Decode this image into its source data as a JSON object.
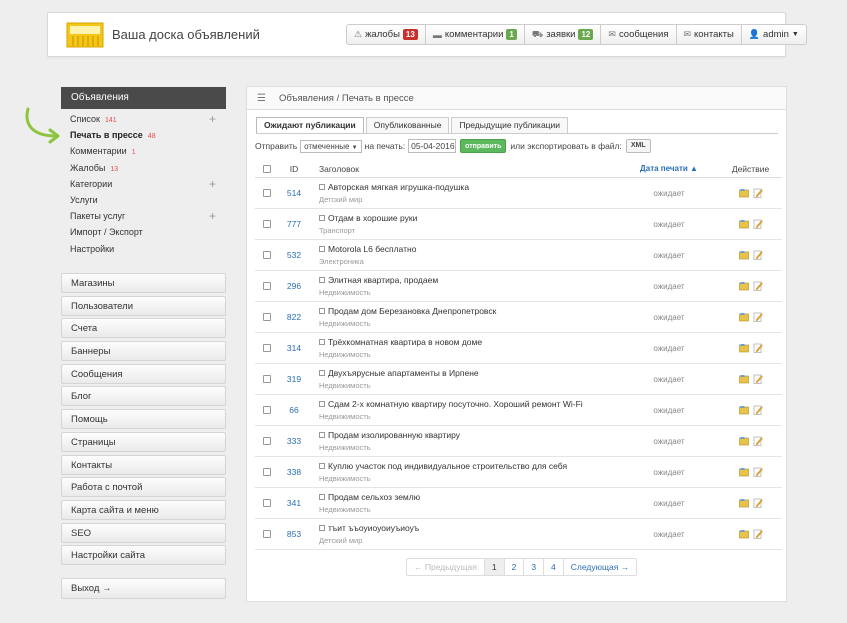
{
  "header": {
    "site_title": "Ваша доска объявлений",
    "nav": [
      {
        "icon": "warning-icon",
        "label": "жалобы",
        "badge": "13",
        "badge_color": "#c9302c"
      },
      {
        "icon": "comment-icon",
        "label": "комментарии",
        "badge": "1",
        "badge_color": "#6aa84f"
      },
      {
        "icon": "cart-icon",
        "label": "заявки",
        "badge": "12",
        "badge_color": "#6aa84f"
      },
      {
        "icon": "envelope-icon",
        "label": "сообщения",
        "badge": null
      },
      {
        "icon": "envelope-icon",
        "label": "контакты",
        "badge": null
      },
      {
        "icon": "user-icon",
        "label": "admin",
        "badge": null
      }
    ]
  },
  "sidebar": {
    "section_title": "Объявления",
    "items": [
      {
        "label": "Список",
        "count": "141",
        "plus": true,
        "active": false
      },
      {
        "label": "Печать в прессе",
        "count": "48",
        "plus": false,
        "active": true
      },
      {
        "label": "Комментарии",
        "count": "1",
        "plus": false,
        "active": false
      },
      {
        "label": "Жалобы",
        "count": "13",
        "plus": false,
        "active": false
      },
      {
        "label": "Категории",
        "count": "",
        "plus": true,
        "active": false
      },
      {
        "label": "Услуги",
        "count": "",
        "plus": false,
        "active": false
      },
      {
        "label": "Пакеты услуг",
        "count": "",
        "plus": true,
        "active": false
      },
      {
        "label": "Импорт / Экспорт",
        "count": "",
        "plus": false,
        "active": false
      },
      {
        "label": "Настройки",
        "count": "",
        "plus": false,
        "active": false
      }
    ],
    "menu": [
      "Магазины",
      "Пользователи",
      "Счета",
      "Баннеры",
      "Сообщения",
      "Блог",
      "Помощь",
      "Страницы",
      "Контакты",
      "Работа с почтой",
      "Карта сайта и меню",
      "SEO",
      "Настройки сайта"
    ],
    "exit_label": "Выход →"
  },
  "main": {
    "breadcrumb": "Объявления / Печать в прессе",
    "tabs": [
      "Ожидают публикации",
      "Опубликованные",
      "Предыдущие публикации"
    ],
    "filter": {
      "send_label": "Отправить",
      "select_value": "отмеченные",
      "to_print_label": "на печать:",
      "date_value": "05-04-2016",
      "send_button": "отправить",
      "export_label": "или экспортировать в файл:",
      "xml_button": "XML"
    },
    "columns": {
      "id": "ID",
      "title": "Заголовок",
      "date": "Дата печати ▲",
      "action": "Действие"
    },
    "rows": [
      {
        "id": "514",
        "title": "Авторская мягкая игрушка-подушка",
        "category": "Детский мир",
        "status": "ожидает"
      },
      {
        "id": "777",
        "title": "Отдам в хорошие руки",
        "category": "Транспорт",
        "status": "ожидает"
      },
      {
        "id": "532",
        "title": "Motorola L6 бесплатно",
        "category": "Электроника",
        "status": "ожидает"
      },
      {
        "id": "296",
        "title": "Элитная квартира, продаем",
        "category": "Недвижимость",
        "status": "ожидает"
      },
      {
        "id": "822",
        "title": "Продам дом Березановка Днепропетровск",
        "category": "Недвижимость",
        "status": "ожидает"
      },
      {
        "id": "314",
        "title": "Трёхкомнатная квартира в новом доме",
        "category": "Недвижимость",
        "status": "ожидает"
      },
      {
        "id": "319",
        "title": "Двухъярусные апартаменты в Ирпене",
        "category": "Недвижимость",
        "status": "ожидает"
      },
      {
        "id": "66",
        "title": "Сдам 2-х комнатную квартиру посуточно. Хороший ремонт Wi-Fi",
        "category": "Недвижимость",
        "status": "ожидает"
      },
      {
        "id": "333",
        "title": "Продам изолированную квартиру",
        "category": "Недвижимость",
        "status": "ожидает"
      },
      {
        "id": "338",
        "title": "Куплю участок под индивидуальное строительство для себя",
        "category": "Недвижимость",
        "status": "ожидает"
      },
      {
        "id": "341",
        "title": "Продам сельхоз землю",
        "category": "Недвижимость",
        "status": "ожидает"
      },
      {
        "id": "853",
        "title": "тъит ъъоуиоуоиуъиоуъ",
        "category": "Детский мир",
        "status": "ожидает"
      }
    ],
    "pager": {
      "prev": "← Предыдущая",
      "pages": [
        "1",
        "2",
        "3",
        "4"
      ],
      "current": "1",
      "next": "Следующая →"
    }
  }
}
